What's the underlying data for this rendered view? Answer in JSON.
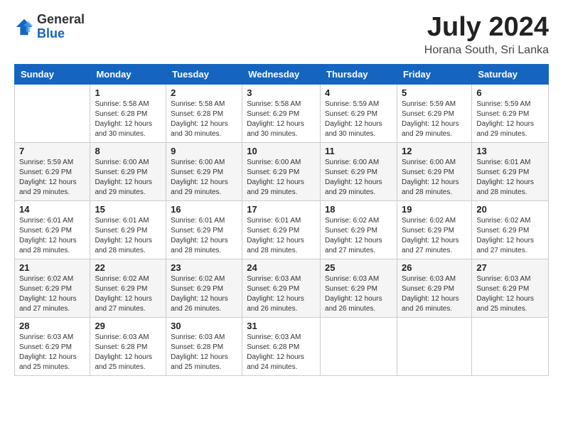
{
  "header": {
    "logo_general": "General",
    "logo_blue": "Blue",
    "month_title": "July 2024",
    "location": "Horana South, Sri Lanka"
  },
  "days_of_week": [
    "Sunday",
    "Monday",
    "Tuesday",
    "Wednesday",
    "Thursday",
    "Friday",
    "Saturday"
  ],
  "weeks": [
    [
      {
        "day": "",
        "sunrise": "",
        "sunset": "",
        "daylight": ""
      },
      {
        "day": "1",
        "sunrise": "Sunrise: 5:58 AM",
        "sunset": "Sunset: 6:28 PM",
        "daylight": "Daylight: 12 hours and 30 minutes."
      },
      {
        "day": "2",
        "sunrise": "Sunrise: 5:58 AM",
        "sunset": "Sunset: 6:28 PM",
        "daylight": "Daylight: 12 hours and 30 minutes."
      },
      {
        "day": "3",
        "sunrise": "Sunrise: 5:58 AM",
        "sunset": "Sunset: 6:29 PM",
        "daylight": "Daylight: 12 hours and 30 minutes."
      },
      {
        "day": "4",
        "sunrise": "Sunrise: 5:59 AM",
        "sunset": "Sunset: 6:29 PM",
        "daylight": "Daylight: 12 hours and 30 minutes."
      },
      {
        "day": "5",
        "sunrise": "Sunrise: 5:59 AM",
        "sunset": "Sunset: 6:29 PM",
        "daylight": "Daylight: 12 hours and 29 minutes."
      },
      {
        "day": "6",
        "sunrise": "Sunrise: 5:59 AM",
        "sunset": "Sunset: 6:29 PM",
        "daylight": "Daylight: 12 hours and 29 minutes."
      }
    ],
    [
      {
        "day": "7",
        "sunrise": "Sunrise: 5:59 AM",
        "sunset": "Sunset: 6:29 PM",
        "daylight": "Daylight: 12 hours and 29 minutes."
      },
      {
        "day": "8",
        "sunrise": "Sunrise: 6:00 AM",
        "sunset": "Sunset: 6:29 PM",
        "daylight": "Daylight: 12 hours and 29 minutes."
      },
      {
        "day": "9",
        "sunrise": "Sunrise: 6:00 AM",
        "sunset": "Sunset: 6:29 PM",
        "daylight": "Daylight: 12 hours and 29 minutes."
      },
      {
        "day": "10",
        "sunrise": "Sunrise: 6:00 AM",
        "sunset": "Sunset: 6:29 PM",
        "daylight": "Daylight: 12 hours and 29 minutes."
      },
      {
        "day": "11",
        "sunrise": "Sunrise: 6:00 AM",
        "sunset": "Sunset: 6:29 PM",
        "daylight": "Daylight: 12 hours and 29 minutes."
      },
      {
        "day": "12",
        "sunrise": "Sunrise: 6:00 AM",
        "sunset": "Sunset: 6:29 PM",
        "daylight": "Daylight: 12 hours and 28 minutes."
      },
      {
        "day": "13",
        "sunrise": "Sunrise: 6:01 AM",
        "sunset": "Sunset: 6:29 PM",
        "daylight": "Daylight: 12 hours and 28 minutes."
      }
    ],
    [
      {
        "day": "14",
        "sunrise": "Sunrise: 6:01 AM",
        "sunset": "Sunset: 6:29 PM",
        "daylight": "Daylight: 12 hours and 28 minutes."
      },
      {
        "day": "15",
        "sunrise": "Sunrise: 6:01 AM",
        "sunset": "Sunset: 6:29 PM",
        "daylight": "Daylight: 12 hours and 28 minutes."
      },
      {
        "day": "16",
        "sunrise": "Sunrise: 6:01 AM",
        "sunset": "Sunset: 6:29 PM",
        "daylight": "Daylight: 12 hours and 28 minutes."
      },
      {
        "day": "17",
        "sunrise": "Sunrise: 6:01 AM",
        "sunset": "Sunset: 6:29 PM",
        "daylight": "Daylight: 12 hours and 28 minutes."
      },
      {
        "day": "18",
        "sunrise": "Sunrise: 6:02 AM",
        "sunset": "Sunset: 6:29 PM",
        "daylight": "Daylight: 12 hours and 27 minutes."
      },
      {
        "day": "19",
        "sunrise": "Sunrise: 6:02 AM",
        "sunset": "Sunset: 6:29 PM",
        "daylight": "Daylight: 12 hours and 27 minutes."
      },
      {
        "day": "20",
        "sunrise": "Sunrise: 6:02 AM",
        "sunset": "Sunset: 6:29 PM",
        "daylight": "Daylight: 12 hours and 27 minutes."
      }
    ],
    [
      {
        "day": "21",
        "sunrise": "Sunrise: 6:02 AM",
        "sunset": "Sunset: 6:29 PM",
        "daylight": "Daylight: 12 hours and 27 minutes."
      },
      {
        "day": "22",
        "sunrise": "Sunrise: 6:02 AM",
        "sunset": "Sunset: 6:29 PM",
        "daylight": "Daylight: 12 hours and 27 minutes."
      },
      {
        "day": "23",
        "sunrise": "Sunrise: 6:02 AM",
        "sunset": "Sunset: 6:29 PM",
        "daylight": "Daylight: 12 hours and 26 minutes."
      },
      {
        "day": "24",
        "sunrise": "Sunrise: 6:03 AM",
        "sunset": "Sunset: 6:29 PM",
        "daylight": "Daylight: 12 hours and 26 minutes."
      },
      {
        "day": "25",
        "sunrise": "Sunrise: 6:03 AM",
        "sunset": "Sunset: 6:29 PM",
        "daylight": "Daylight: 12 hours and 26 minutes."
      },
      {
        "day": "26",
        "sunrise": "Sunrise: 6:03 AM",
        "sunset": "Sunset: 6:29 PM",
        "daylight": "Daylight: 12 hours and 26 minutes."
      },
      {
        "day": "27",
        "sunrise": "Sunrise: 6:03 AM",
        "sunset": "Sunset: 6:29 PM",
        "daylight": "Daylight: 12 hours and 25 minutes."
      }
    ],
    [
      {
        "day": "28",
        "sunrise": "Sunrise: 6:03 AM",
        "sunset": "Sunset: 6:29 PM",
        "daylight": "Daylight: 12 hours and 25 minutes."
      },
      {
        "day": "29",
        "sunrise": "Sunrise: 6:03 AM",
        "sunset": "Sunset: 6:28 PM",
        "daylight": "Daylight: 12 hours and 25 minutes."
      },
      {
        "day": "30",
        "sunrise": "Sunrise: 6:03 AM",
        "sunset": "Sunset: 6:28 PM",
        "daylight": "Daylight: 12 hours and 25 minutes."
      },
      {
        "day": "31",
        "sunrise": "Sunrise: 6:03 AM",
        "sunset": "Sunset: 6:28 PM",
        "daylight": "Daylight: 12 hours and 24 minutes."
      },
      {
        "day": "",
        "sunrise": "",
        "sunset": "",
        "daylight": ""
      },
      {
        "day": "",
        "sunrise": "",
        "sunset": "",
        "daylight": ""
      },
      {
        "day": "",
        "sunrise": "",
        "sunset": "",
        "daylight": ""
      }
    ]
  ]
}
